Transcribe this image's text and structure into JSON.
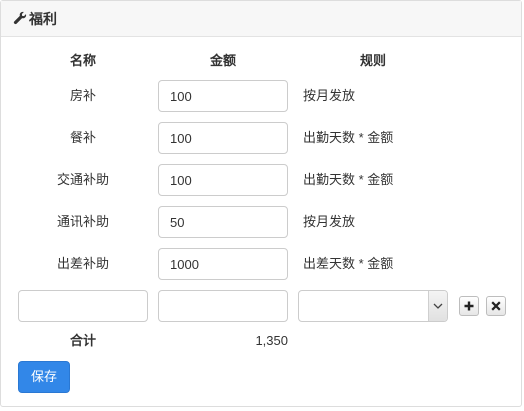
{
  "panel": {
    "title": "福利",
    "icon": "wrench-icon"
  },
  "columns": {
    "name": "名称",
    "amount": "金额",
    "rule": "规则"
  },
  "rows": [
    {
      "name": "房补",
      "amount": "100",
      "rule": "按月发放"
    },
    {
      "name": "餐补",
      "amount": "100",
      "rule": "出勤天数 * 金额"
    },
    {
      "name": "交通补助",
      "amount": "100",
      "rule": "出勤天数 * 金额"
    },
    {
      "name": "通讯补助",
      "amount": "50",
      "rule": "按月发放"
    },
    {
      "name": "出差补助",
      "amount": "1000",
      "rule": "出差天数 * 金额"
    }
  ],
  "new_row": {
    "name": "",
    "amount": "",
    "rule_selected": "",
    "add_icon": "plus-icon",
    "remove_icon": "times-icon"
  },
  "total": {
    "label": "合计",
    "value": "1,350"
  },
  "actions": {
    "save_label": "保存"
  },
  "colors": {
    "primary": "#3287e8",
    "heading_bg": "#f7f7f7",
    "border": "#cccccc"
  }
}
